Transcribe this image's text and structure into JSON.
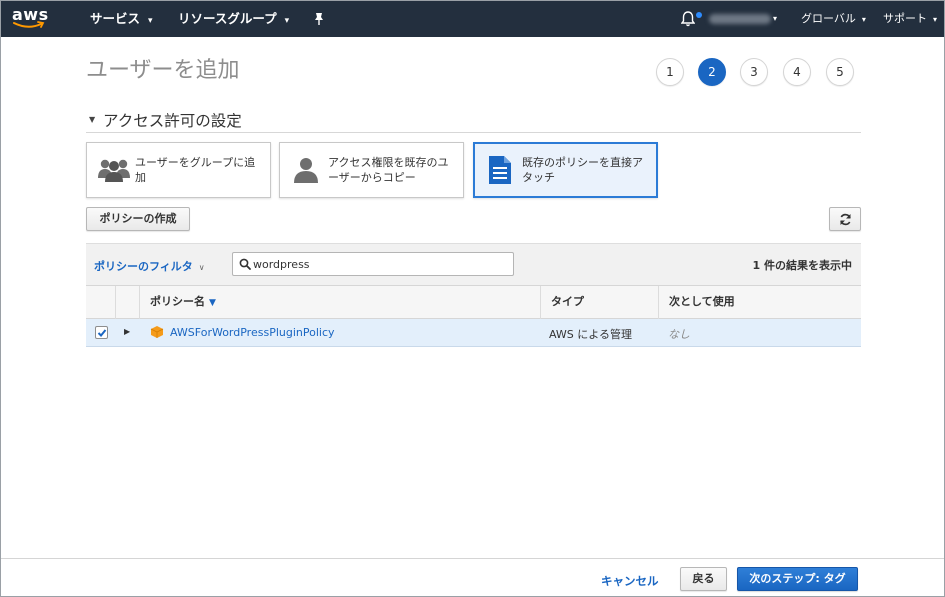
{
  "nav": {
    "logo": "aws",
    "services": "サービス",
    "resource_groups": "リソースグループ",
    "account": "",
    "region": "グローバル",
    "support": "サポート"
  },
  "page": {
    "title": "ユーザーを追加",
    "steps": [
      "1",
      "2",
      "3",
      "4",
      "5"
    ],
    "active_step": 2
  },
  "section": {
    "title": "アクセス許可の設定"
  },
  "options": [
    {
      "label": "ユーザーをグループに追加",
      "icon": "group-icon"
    },
    {
      "label": "アクセス権限を既存のユーザーからコピー",
      "icon": "user-icon"
    },
    {
      "label": "既存のポリシーを直接アタッチ",
      "icon": "document-icon"
    }
  ],
  "toolbar": {
    "create_policy": "ポリシーの作成"
  },
  "filter": {
    "label": "ポリシーのフィルタ",
    "search_value": "wordpress",
    "result_count": "1 件の結果を表示中"
  },
  "table": {
    "headers": {
      "name": "ポリシー名",
      "type": "タイプ",
      "used_as": "次として使用"
    },
    "rows": [
      {
        "checked": true,
        "name": "AWSForWordPressPluginPolicy",
        "type": "AWS による管理",
        "used_as": "なし"
      }
    ]
  },
  "footer": {
    "cancel": "キャンセル",
    "back": "戻る",
    "next": "次のステップ: タグ"
  },
  "colors": {
    "nav_bg": "#232f3e",
    "accent": "#1a66c2",
    "selected_row": "#e3effb",
    "aws_orange": "#ff9900"
  }
}
